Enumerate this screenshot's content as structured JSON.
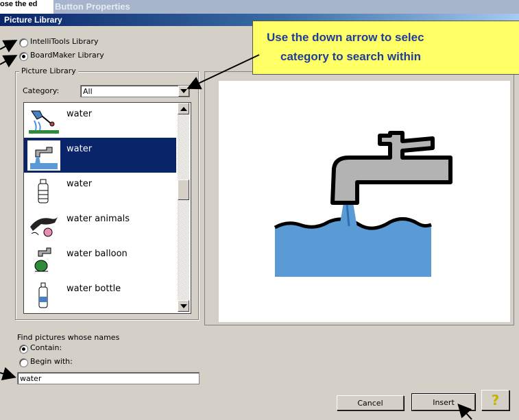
{
  "background_window": {
    "title_cut": "ose the ed",
    "title": "Button Properties"
  },
  "dialog": {
    "title": "Picture Library"
  },
  "library": {
    "options": [
      {
        "label": "IntelliTools Library",
        "selected": false
      },
      {
        "label": "BoardMaker Library",
        "selected": true
      }
    ]
  },
  "picture_library": {
    "group_label": "Picture Library",
    "category_label": "Category:",
    "category_value": "All",
    "items": [
      {
        "label": "water",
        "icon": "watering-can-icon",
        "selected": false
      },
      {
        "label": "water",
        "icon": "faucet-icon",
        "selected": true
      },
      {
        "label": "water",
        "icon": "bottle-icon",
        "selected": false
      },
      {
        "label": "water animals",
        "icon": "dolphin-icon",
        "selected": false
      },
      {
        "label": "water balloon",
        "icon": "balloon-faucet-icon",
        "selected": false
      },
      {
        "label": "water bottle",
        "icon": "bottle-icon",
        "selected": false
      }
    ]
  },
  "find": {
    "label": "Find pictures whose names",
    "options": [
      {
        "label": "Contain:",
        "selected": true
      },
      {
        "label": "Begin with:",
        "selected": false
      }
    ],
    "search_value": "water"
  },
  "buttons": {
    "cancel": "Cancel",
    "insert": "Insert",
    "help": "?"
  },
  "callout": {
    "line1": "Use the down arrow to selec",
    "line2": "category to search within"
  },
  "colors": {
    "selection": "#0a246a",
    "callout_bg": "#ffff66",
    "callout_text": "#1f3d99",
    "water": "#5b9bd5"
  }
}
